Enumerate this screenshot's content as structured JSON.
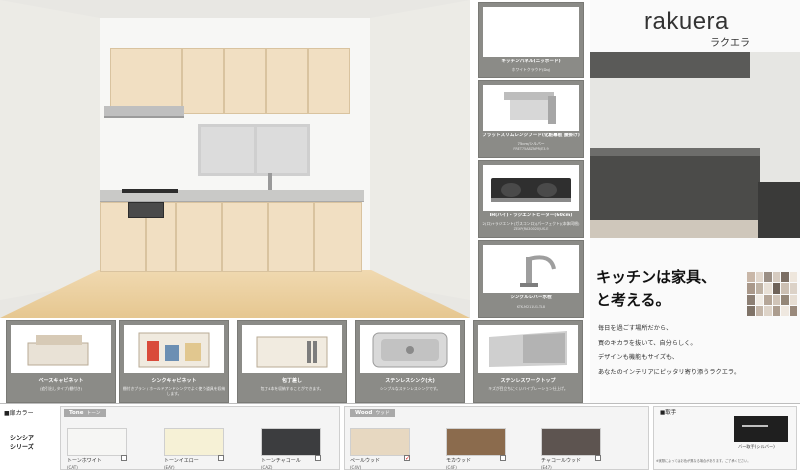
{
  "brand": {
    "logo": "rakuera",
    "logo_kana": "ラクエラ",
    "tagline_1": "キッチンは家具、",
    "tagline_2": "と考える。",
    "body": [
      "毎日を過ごす場所だから、",
      "買のキカラを抜いて、自分らしく。",
      "デザインも機能もサイズも、",
      "あなたのインテリアにピッタリ寄り添うラクエラ。"
    ]
  },
  "features": [
    {
      "label": "キッチンパネル(ニッポード)",
      "sub": "ホワイトクラウド(Dq)",
      "code": ""
    },
    {
      "label": "フラットスリムレンジフード(化粧幕板 腰掛け)",
      "sub": "75cm/シルバー",
      "code": "FRET75A8ZNPR/E3.9"
    },
    {
      "label": "IH(ハイ)・ラジエントヒーター(60cm)",
      "sub": "2(ロ)+ラジエント(ガスコンロ)(パーフェクト)(本体同梱)",
      "code": "ZEXP(RA30020)US-E"
    },
    {
      "label": "シングルレバー水栓",
      "sub": "",
      "code": "KTK-M211U1-TL8"
    }
  ],
  "bottom_cards": [
    {
      "label": "ベースキャビネット",
      "sub": "(追引出しタイプ(棚付き)"
    },
    {
      "label": "シンクキャビネット",
      "sub": "棚付きプラン / ホールドアンドシンクでよく使う道具を収納します。"
    },
    {
      "label": "包丁差し",
      "sub": "包丁4本を収納することができます。"
    },
    {
      "label": "ステンレスシンク(大)",
      "sub": "シンプルなステンレスシンクです。"
    },
    {
      "label": "ステンレスワークトップ",
      "sub": "キズが目立ちにくいバイブレーション仕上げ。"
    }
  ],
  "selector": {
    "heading": "■扉カラー",
    "series_1": "シンシア",
    "series_2": "シリーズ",
    "tone_label": "Tone",
    "tone_kana": "トーン",
    "wood_label": "Wood",
    "wood_kana": "ウッド",
    "colors": [
      {
        "name": "トーンホワイト",
        "code": "(CAT)",
        "hex": "#f6f6f4"
      },
      {
        "name": "トーンイエロー",
        "code": "(EAY)",
        "hex": "#f6f1d6"
      },
      {
        "name": "トーンチャコール",
        "code": "(CAZ)",
        "hex": "#3c3d3f"
      },
      {
        "name": "ペールウッド",
        "code": "(C4V)",
        "hex": "#e7d8c1"
      },
      {
        "name": "モカウッド",
        "code": "(C4F)",
        "hex": "#8b6b4d"
      },
      {
        "name": "チャコールウッド",
        "code": "(E47)",
        "hex": "#5d5450"
      }
    ],
    "selected_check": "✓",
    "handle_heading": "■取手",
    "handle_name": "バー取手(シルバー)",
    "handle_note": "※実際によってはお色が異なる場合があります。ご了承ください。"
  },
  "swatch_colors": [
    "#c9b7a8",
    "#e2d7cc",
    "#9b8f85",
    "#d6cbc0",
    "#7b6e64",
    "#eee6dc",
    "#a9988a",
    "#bfb2a4",
    "#e8e0d6",
    "#6e6259",
    "#cbbfb3",
    "#dcd2c7",
    "#8c7f74",
    "#f0ebe4",
    "#b5a698",
    "#d0c4b8",
    "#948779",
    "#e6ddd2",
    "#7f7368",
    "#c4b6a9",
    "#ddd3c8",
    "#ac9d8f",
    "#efe8e0",
    "#99897b"
  ]
}
